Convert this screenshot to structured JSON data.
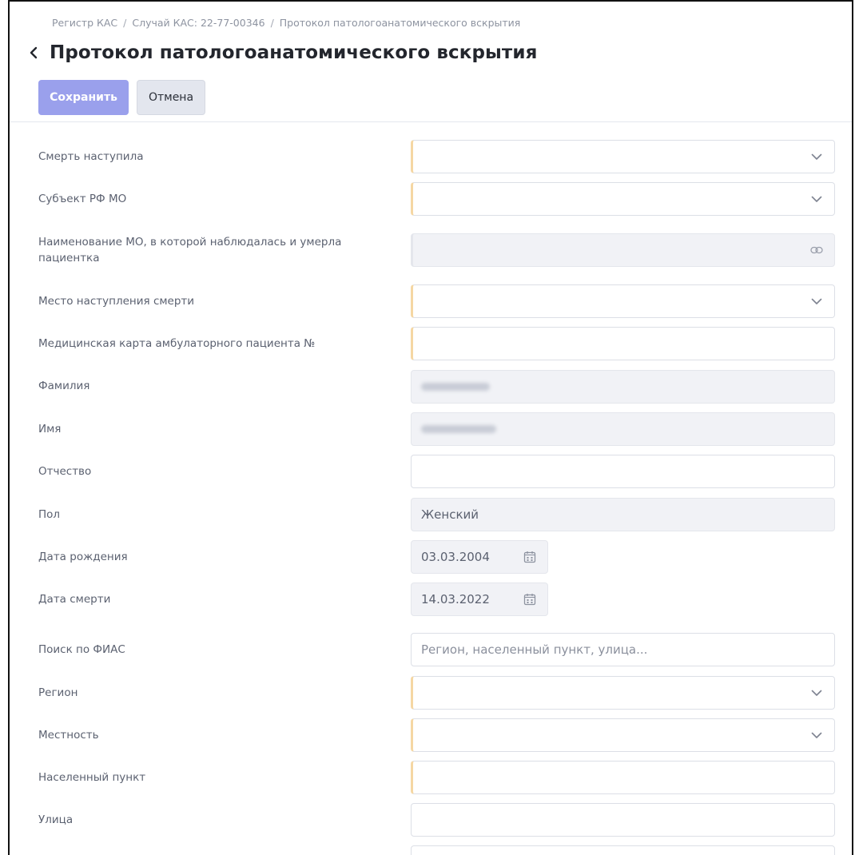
{
  "breadcrumb": {
    "items": [
      "Регистр КАС",
      "Случай КАС: 22-77-00346",
      "Протокол патологоанатомического вскрытия"
    ],
    "separator": "/"
  },
  "header": {
    "title": "Протокол патологоанатомического вскрытия",
    "back_icon": "chevron-left-icon"
  },
  "toolbar": {
    "save_label": "Сохранить",
    "cancel_label": "Отмена"
  },
  "colors": {
    "primary_button": "#9aa0ec",
    "required_marker": "#f5d7a3",
    "readonly_bg": "#f1f2f6"
  },
  "form": {
    "death_occurred": {
      "label": "Смерть наступила",
      "value": "",
      "icon": "chevron-down-icon"
    },
    "subject_mo": {
      "label": "Субъект РФ МО",
      "value": "",
      "icon": "chevron-down-icon"
    },
    "mo_name": {
      "label_line1": "Наименование МО, в которой наблюдалась и умерла",
      "label_line2": "пациентка",
      "value": "",
      "icon": "link-icon"
    },
    "death_place": {
      "label": "Место наступления смерти",
      "value": "",
      "icon": "chevron-down-icon"
    },
    "med_card": {
      "label": "Медицинская карта амбулаторного пациента №",
      "value": ""
    },
    "last_name": {
      "label": "Фамилия"
    },
    "first_name": {
      "label": "Имя"
    },
    "patronymic": {
      "label": "Отчество",
      "value": ""
    },
    "sex": {
      "label": "Пол",
      "value": "Женский"
    },
    "birth_date": {
      "label": "Дата рождения",
      "value": "03.03.2004",
      "icon": "calendar-icon"
    },
    "death_date": {
      "label": "Дата смерти",
      "value": "14.03.2022",
      "icon": "calendar-icon"
    },
    "fias_search": {
      "label": "Поиск по ФИАС",
      "placeholder": "Регион, населенный пункт, улица..."
    },
    "region": {
      "label": "Регион",
      "value": "",
      "icon": "chevron-down-icon"
    },
    "locality": {
      "label": "Местность",
      "value": "",
      "icon": "chevron-down-icon"
    },
    "settlement": {
      "label": "Населенный пункт",
      "value": ""
    },
    "street": {
      "label": "Улица",
      "value": ""
    }
  }
}
